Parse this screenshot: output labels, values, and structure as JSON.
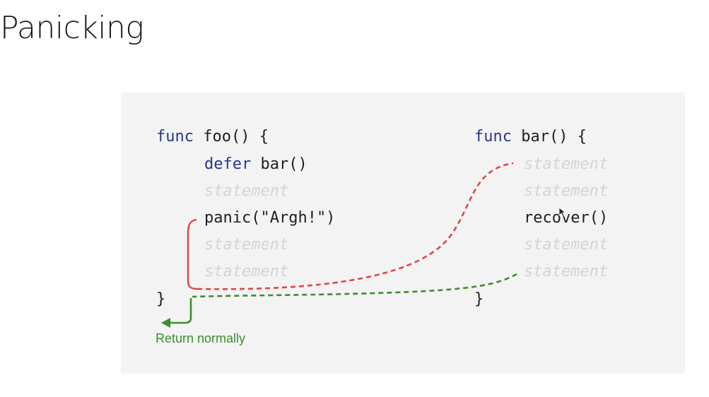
{
  "slide": {
    "title": "Panicking"
  },
  "foo": {
    "keyword": "func",
    "signature": "foo() {",
    "lines": [
      {
        "keyword": "defer",
        "text": "bar()"
      },
      {
        "text": "statement"
      },
      {
        "text": "panic(\"Argh!\")"
      },
      {
        "text": "statement"
      },
      {
        "text": "statement"
      }
    ],
    "closing": "}"
  },
  "bar": {
    "keyword": "func",
    "signature": "bar() {",
    "lines": [
      {
        "text": "statement"
      },
      {
        "text": "statement"
      },
      {
        "text": "recover()"
      },
      {
        "text": "statement"
      },
      {
        "text": "statement"
      }
    ],
    "closing": "}"
  },
  "annotation": {
    "return_label": "Return normally"
  },
  "colors": {
    "keyword": "#283593",
    "code": "#1f1f1f",
    "faded_statement": "#d4d4d4",
    "panic_path": "#e04545",
    "return_path": "#3f8b2e",
    "panel_background": "#f3f3f3"
  },
  "icons": {
    "cursor": "mouse-cursor-icon",
    "return_arrow": "arrow-left-icon"
  }
}
